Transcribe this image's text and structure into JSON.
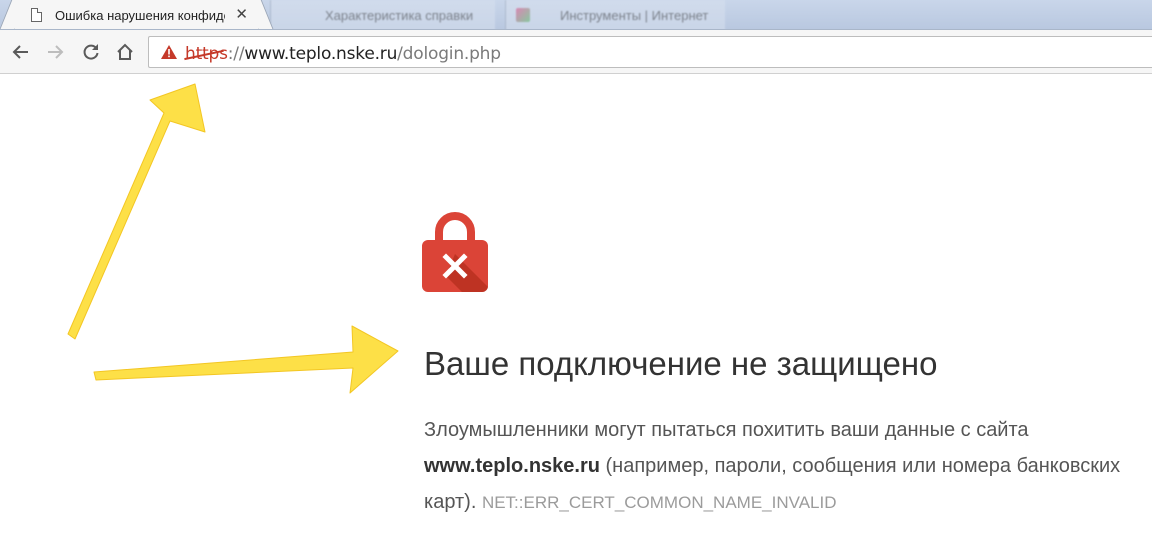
{
  "tabs": [
    {
      "title": "Ошибка нарушения конфиденциальности",
      "active": true,
      "close": "✕"
    },
    {
      "title": "Характеристика справки",
      "active": false
    },
    {
      "title": "Инструменты | Интернет",
      "active": false
    }
  ],
  "toolbar": {
    "back_icon": "←",
    "forward_icon": "→",
    "reload_icon": "⟳",
    "home_icon": "⌂"
  },
  "address_bar": {
    "scheme": "https",
    "separator": "://",
    "host": "www.teplo.nske.ru",
    "path": "/dologin.php",
    "security_state": "not-secure"
  },
  "interstitial": {
    "heading": "Ваше подключение не защищено",
    "text_before": "Злоумышленники могут пытаться похитить ваши данные с сайта ",
    "host": "www.teplo.nske.ru",
    "text_after": " (например, пароли, сообщения или номера банковских карт). ",
    "error_code": "NET::ERR_CERT_COMMON_NAME_INVALID"
  },
  "colors": {
    "danger_red": "#db4437",
    "annotation_yellow": "#fde047",
    "heading_text": "#333333",
    "body_text": "#555555"
  }
}
